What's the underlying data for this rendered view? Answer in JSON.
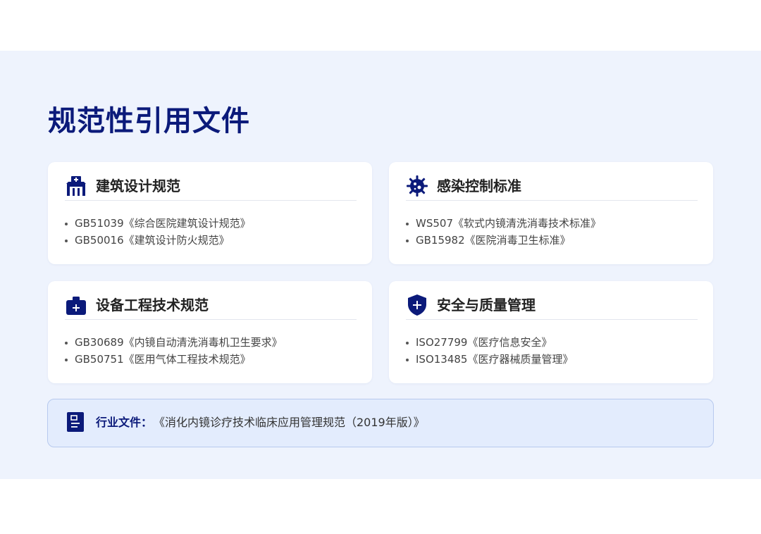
{
  "title": "规范性引用文件",
  "accent_color": "#0b1a7a",
  "cards": [
    {
      "icon": "hospital-icon",
      "title": "建筑设计规范",
      "items": [
        "GB51039《综合医院建筑设计规范》",
        "GB50016《建筑设计防火规范》"
      ]
    },
    {
      "icon": "virus-icon",
      "title": "感染控制标准",
      "items": [
        "WS507《软式内镜清洗消毒技术标准》",
        "GB15982《医院消毒卫生标准》"
      ]
    },
    {
      "icon": "medical-kit-icon",
      "title": "设备工程技术规范",
      "items": [
        "GB30689《内镜自动清洗消毒机卫生要求》",
        "GB50751《医用气体工程技术规范》"
      ]
    },
    {
      "icon": "shield-plus-icon",
      "title": "安全与质量管理",
      "items": [
        "ISO27799《医疗信息安全》",
        "ISO13485《医疗器械质量管理》"
      ]
    }
  ],
  "footer": {
    "icon": "document-icon",
    "label": "行业文件：",
    "text": "《消化内镜诊疗技术临床应用管理规范（2019年版）》"
  }
}
